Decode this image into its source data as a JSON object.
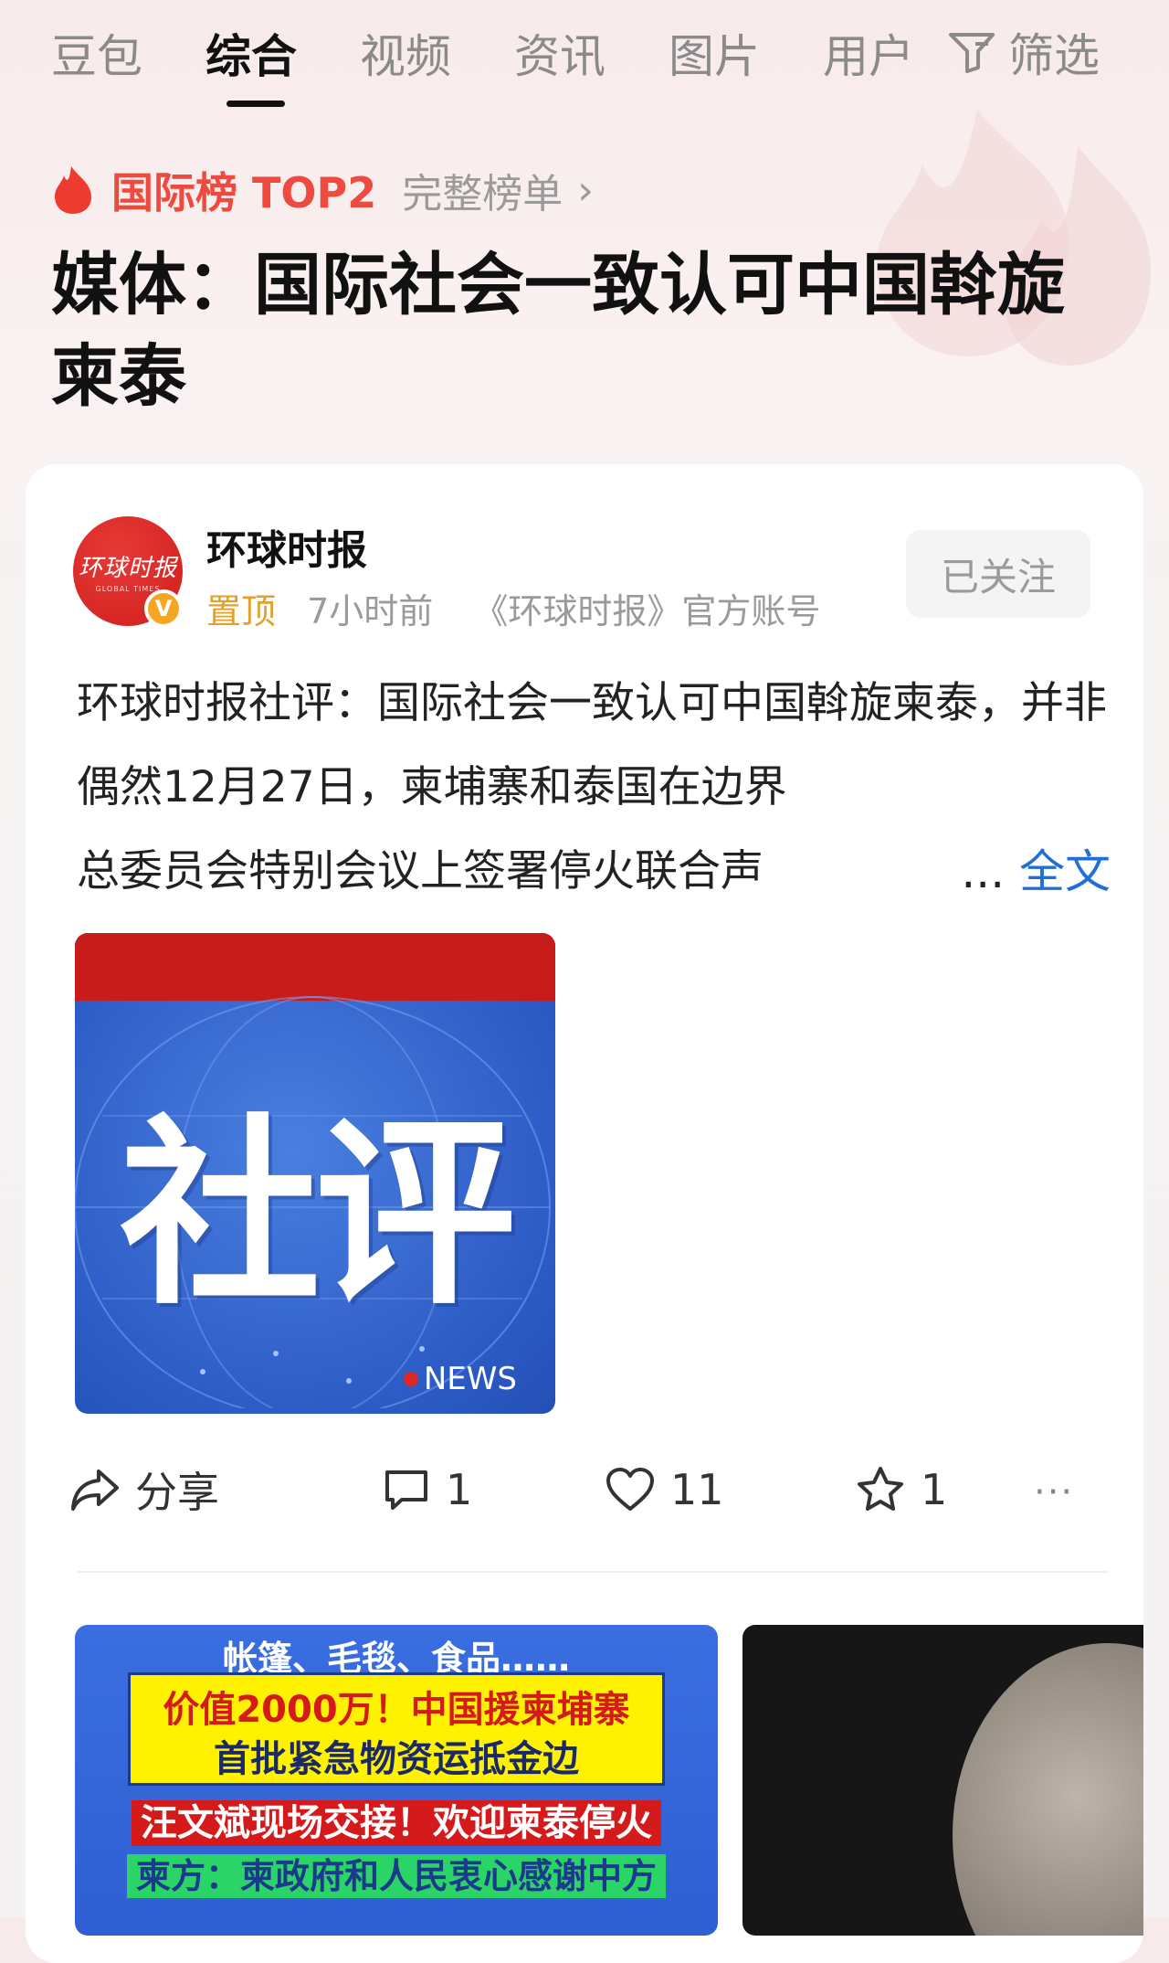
{
  "tabs": [
    "豆包",
    "综合",
    "视频",
    "资讯",
    "图片",
    "用户"
  ],
  "active_tab": "综合",
  "filter_label": "筛选",
  "hot_rank": {
    "label": "国际榜 TOP2",
    "full_list": "完整榜单",
    "chevron": "›"
  },
  "headline": "媒体：国际社会一致认可中国斡旋柬泰",
  "post": {
    "avatar_text": "环球时报",
    "avatar_subtext": "GLOBAL TIMES",
    "verified_mark": "V",
    "author": "环球时报",
    "pinned": "置顶",
    "time": "7小时前",
    "account_desc": "《环球时报》官方账号",
    "follow_label": "已关注",
    "text": "环球时报社评：国际社会一致认可中国斡旋柬泰，并非偶然12月27日，柬埔寨和泰国在边界",
    "text_line3": "总委员会特别会议上签署停火联合声",
    "more_ellipsis": "...",
    "more_label": "全文",
    "image_title": "社评",
    "image_badge": "NEWS",
    "share_label": "分享",
    "comments": "1",
    "likes": "11",
    "favorites": "1",
    "more_dots": "···"
  },
  "related_thumb": {
    "line1": "帐篷、毛毯、食品……",
    "line2": "价值2000万！中国援柬埔寨",
    "line3": "首批紧急物资运抵金边",
    "line4": "汪文斌现场交接！欢迎柬泰停火",
    "line5": "柬方：柬政府和人民衷心感谢中方"
  },
  "colors": {
    "accent_red": "#ef4a3f",
    "link_blue": "#1f6fd6",
    "pin_orange": "#e3a12c",
    "muted_gray": "#9a9a9a"
  },
  "icons": [
    "filter-icon",
    "flame-icon",
    "chevron-right-icon",
    "share-icon",
    "comment-icon",
    "heart-icon",
    "star-icon",
    "more-icon"
  ]
}
